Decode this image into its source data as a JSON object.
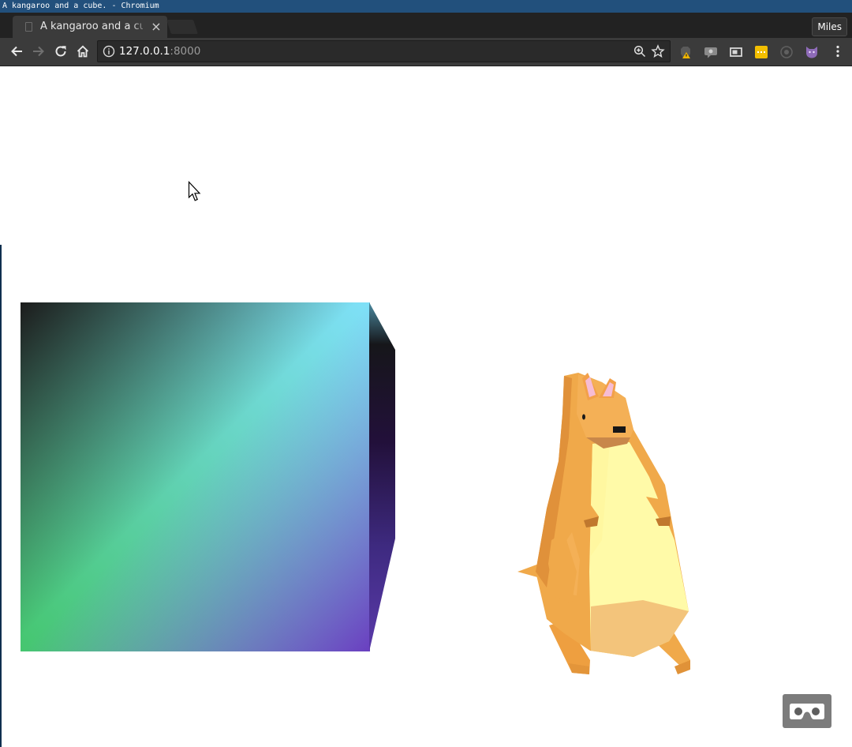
{
  "window": {
    "title": "A kangaroo and a cube. - Chromium"
  },
  "tabs": [
    {
      "title": "A kangaroo and a cu",
      "active": true
    }
  ],
  "profile": {
    "name": "Miles"
  },
  "toolbar": {
    "back_icon": "arrow-left-icon",
    "forward_icon": "arrow-right-icon",
    "reload_icon": "reload-icon",
    "home_icon": "home-icon"
  },
  "address_bar": {
    "host": "127.0.0.1",
    "port": ":8000"
  },
  "extensions": [
    "extension-warning-icon",
    "extension-chat-icon",
    "extension-cast-icon",
    "extension-yellow-icon",
    "extension-circle-icon",
    "extension-cat-icon"
  ],
  "scene": {
    "objects": [
      "gradient-cube",
      "low-poly-kangaroo"
    ],
    "vr_button": "vr-headset-icon"
  },
  "colors": {
    "titlebar": "#22507c",
    "tabstrip": "#222222",
    "toolbar": "#3b3b3b",
    "cube_face_top_right": "#7fe0f8",
    "cube_face_bottom_left": "#45c66f",
    "cube_face_bottom_right": "#6a3fc0",
    "kangaroo_fur": "#f0a94a",
    "kangaroo_belly": "#fffaa8"
  }
}
